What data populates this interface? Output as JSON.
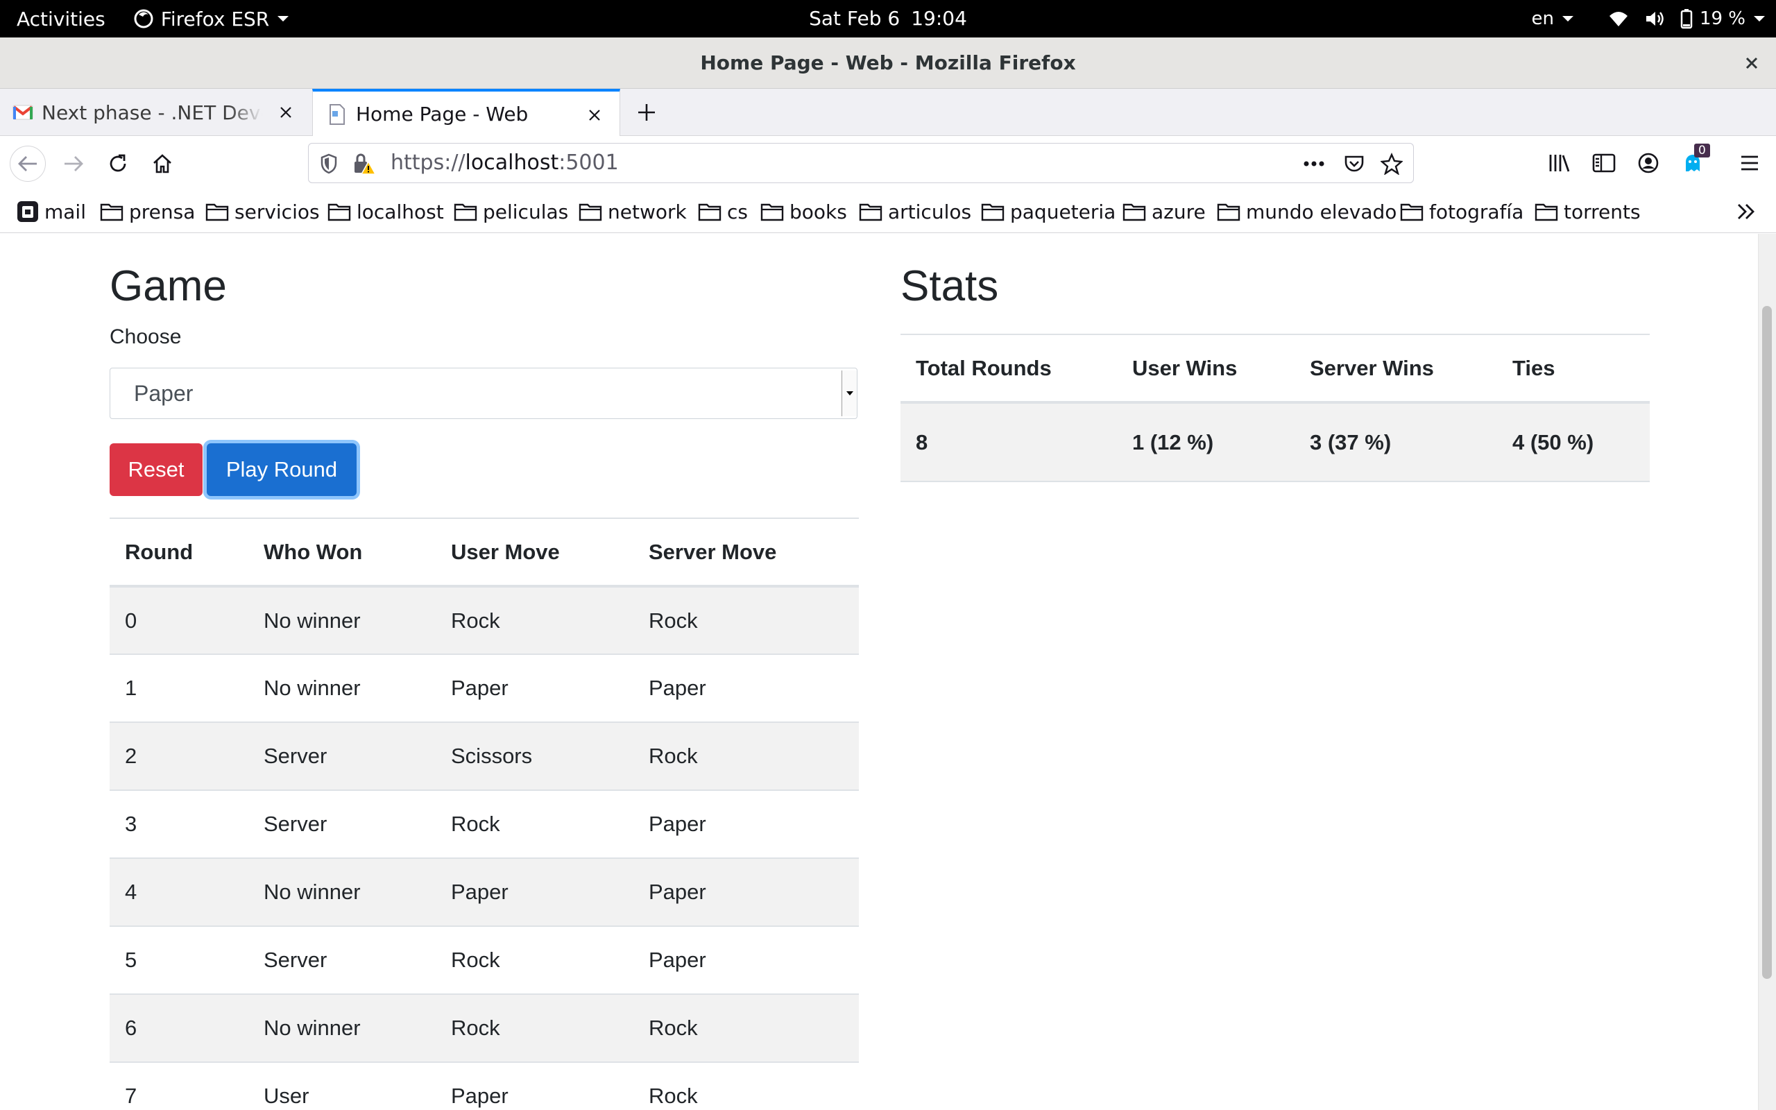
{
  "system_bar": {
    "activities": "Activities",
    "app_name": "Firefox ESR",
    "date": "Sat Feb 6",
    "time": "19:04",
    "language": "en",
    "battery": "19 %"
  },
  "window": {
    "title": "Home Page - Web - Mozilla Firefox"
  },
  "tabs": [
    {
      "label": "Next phase - .NET Developer",
      "icon": "gmail-icon",
      "active": false
    },
    {
      "label": "Home Page - Web",
      "icon": "page-icon",
      "active": true
    }
  ],
  "navbar": {
    "url_scheme": "https://",
    "url_host": "localhost",
    "url_port": ":5001",
    "extension_badge": "0"
  },
  "bookmarks": [
    {
      "label": "mail",
      "icon": "proton-icon"
    },
    {
      "label": "prensa",
      "icon": "folder-icon"
    },
    {
      "label": "servicios",
      "icon": "folder-icon"
    },
    {
      "label": "localhost",
      "icon": "folder-icon"
    },
    {
      "label": "peliculas",
      "icon": "folder-icon"
    },
    {
      "label": "network",
      "icon": "folder-icon"
    },
    {
      "label": "cs",
      "icon": "folder-icon"
    },
    {
      "label": "books",
      "icon": "folder-icon"
    },
    {
      "label": "articulos",
      "icon": "folder-icon"
    },
    {
      "label": "paqueteria",
      "icon": "folder-icon"
    },
    {
      "label": "azure",
      "icon": "folder-icon"
    },
    {
      "label": "mundo elevado",
      "icon": "folder-icon"
    },
    {
      "label": "fotografía",
      "icon": "folder-icon"
    },
    {
      "label": "torrents",
      "icon": "folder-icon"
    }
  ],
  "game": {
    "title": "Game",
    "choose_label": "Choose",
    "selected_move": "Paper",
    "reset_label": "Reset",
    "play_label": "Play Round",
    "columns": [
      "Round",
      "Who Won",
      "User Move",
      "Server Move"
    ],
    "rows": [
      [
        "0",
        "No winner",
        "Rock",
        "Rock"
      ],
      [
        "1",
        "No winner",
        "Paper",
        "Paper"
      ],
      [
        "2",
        "Server",
        "Scissors",
        "Rock"
      ],
      [
        "3",
        "Server",
        "Rock",
        "Paper"
      ],
      [
        "4",
        "No winner",
        "Paper",
        "Paper"
      ],
      [
        "5",
        "Server",
        "Rock",
        "Paper"
      ],
      [
        "6",
        "No winner",
        "Rock",
        "Rock"
      ],
      [
        "7",
        "User",
        "Paper",
        "Rock"
      ]
    ]
  },
  "stats": {
    "title": "Stats",
    "columns": [
      "Total Rounds",
      "User Wins",
      "Server Wins",
      "Ties"
    ],
    "values": [
      "8",
      "1 (12 %)",
      "3 (37 %)",
      "4 (50 %)"
    ]
  },
  "colors": {
    "reset_button": "#dc3545",
    "play_button": "#1a6fd1",
    "active_tab_accent": "#0a84ff"
  }
}
